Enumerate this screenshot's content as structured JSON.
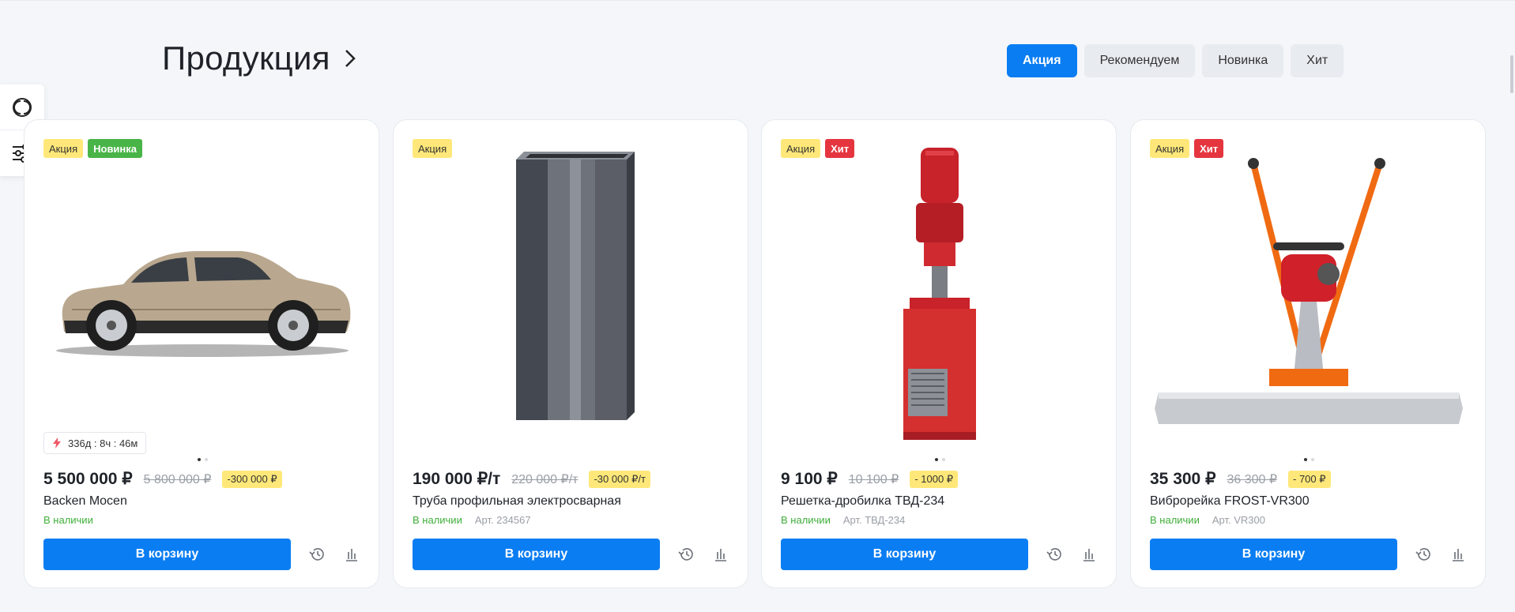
{
  "page": {
    "title": "Продукция"
  },
  "tabs": [
    {
      "label": "Акция",
      "active": true
    },
    {
      "label": "Рекомендуем",
      "active": false
    },
    {
      "label": "Новинка",
      "active": false
    },
    {
      "label": "Хит",
      "active": false
    }
  ],
  "side_panel": {
    "icons": [
      "compare-circles-icon",
      "filter-sliders-icon"
    ]
  },
  "colors": {
    "accent": "#0a7df2",
    "sale_badge": "#ffe879",
    "new_badge": "#49b447",
    "hit_badge": "#e5363f",
    "in_stock": "#3fae3a"
  },
  "products": [
    {
      "badges": [
        "Акция",
        "Новинка"
      ],
      "timer": "336д : 8ч : 46м",
      "price": "5 500 000 ₽",
      "old_price": "5 800 000 ₽",
      "discount": "-300 000 ₽",
      "name": "Backen Mocen",
      "stock": "В наличии",
      "article": "",
      "cart_label": "В корзину",
      "image": "car"
    },
    {
      "badges": [
        "Акция"
      ],
      "timer": "",
      "price": "190 000 ₽/т",
      "old_price": "220 000 ₽/т",
      "discount": "-30 000 ₽/т",
      "name": "Труба профильная электросварная",
      "stock": "В наличии",
      "article": "Арт. 234567",
      "cart_label": "В корзину",
      "image": "pipe"
    },
    {
      "badges": [
        "Акция",
        "Хит"
      ],
      "timer": "",
      "price": "9 100 ₽",
      "old_price": "10 100 ₽",
      "discount": "- 1000 ₽",
      "name": "Решетка-дробилка ТВД-234",
      "stock": "В наличии",
      "article": "Арт. ТВД-234",
      "cart_label": "В корзину",
      "image": "crusher"
    },
    {
      "badges": [
        "Акция",
        "Хит"
      ],
      "timer": "",
      "price": "35 300 ₽",
      "old_price": "36 300 ₽",
      "discount": "- 700 ₽",
      "name": "Виброрейка FROST-VR300",
      "stock": "В наличии",
      "article": "Арт. VR300",
      "cart_label": "В корзину",
      "image": "screed"
    }
  ]
}
